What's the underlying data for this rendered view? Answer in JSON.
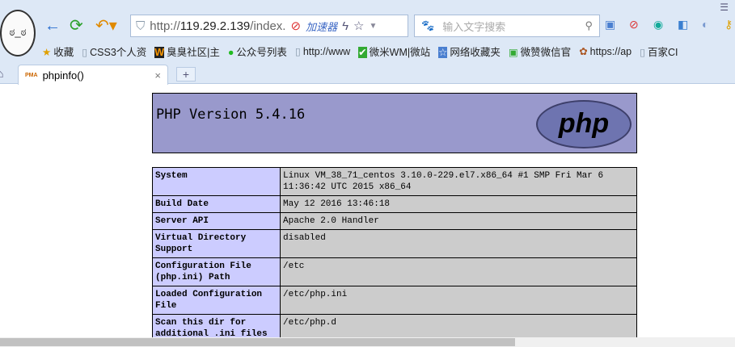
{
  "browser": {
    "avatar_face": "ಠ_ಠ",
    "address": {
      "prefix": "http://",
      "host": "119.29.2.139",
      "path": "/index.",
      "accelerator": "加速器"
    },
    "search_placeholder": "输入文字搜索",
    "bookmarks": [
      {
        "icon": "★",
        "label": "收藏"
      },
      {
        "icon": "▯",
        "label": "CSS3个人资"
      },
      {
        "icon": "W",
        "label": "臭臭社区|主"
      },
      {
        "icon": "●",
        "label": "公众号列表"
      },
      {
        "icon": "▯",
        "label": "http://www"
      },
      {
        "icon": "✔",
        "label": "微米WM|微站"
      },
      {
        "icon": "☆",
        "label": "网络收藏夹"
      },
      {
        "icon": "▣",
        "label": "微赞微信官"
      },
      {
        "icon": "✿",
        "label": "https://ap"
      },
      {
        "icon": "▯",
        "label": "百家CI"
      }
    ],
    "tab": {
      "label": "phpinfo()",
      "icon": "PMA"
    },
    "new_tab": "+",
    "close": "×"
  },
  "php": {
    "version_title": "PHP Version 5.4.16",
    "logo_text": "php",
    "rows": [
      {
        "key": "System",
        "value": "Linux VM_38_71_centos 3.10.0-229.el7.x86_64 #1 SMP Fri Mar 6 11:36:42 UTC 2015 x86_64"
      },
      {
        "key": "Build Date",
        "value": "May 12 2016 13:46:18"
      },
      {
        "key": "Server API",
        "value": "Apache 2.0 Handler"
      },
      {
        "key": "Virtual Directory Support",
        "value": "disabled"
      },
      {
        "key": "Configuration File (php.ini) Path",
        "value": "/etc"
      },
      {
        "key": "Loaded Configuration File",
        "value": "/etc/php.ini"
      },
      {
        "key": "Scan this dir for additional .ini files",
        "value": "/etc/php.d"
      }
    ]
  }
}
